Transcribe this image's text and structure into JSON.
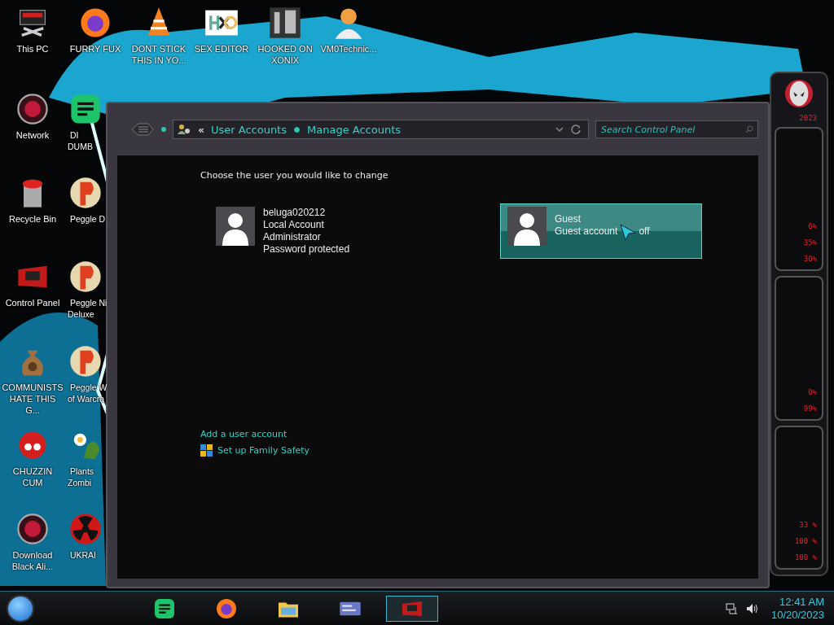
{
  "desktop": {
    "top_row": [
      {
        "label": "This PC",
        "kind": "monitor"
      },
      {
        "label": "FURRY FUX",
        "kind": "browser"
      },
      {
        "label": "DONT STICK THIS IN YO...",
        "kind": "cone"
      },
      {
        "label": "SEX EDITOR",
        "kind": "hex"
      },
      {
        "label": "HOOKED ON XONIX",
        "kind": "maze"
      },
      {
        "label": "VM0Technic...",
        "kind": "person"
      }
    ],
    "column_1": [
      {
        "label": "Network",
        "kind": "orb"
      },
      {
        "label": "Recycle Bin",
        "kind": "bin"
      },
      {
        "label": "Control Panel",
        "kind": "panel"
      },
      {
        "label": "COMMUNISTS HATE THIS G...",
        "kind": "bag"
      },
      {
        "label": "CHUZZIN CUM",
        "kind": "fuzz"
      },
      {
        "label": "Download Black Ali...",
        "kind": "orb"
      }
    ],
    "column_2": [
      {
        "label": "DI\nDUMB",
        "kind": "note"
      },
      {
        "label": "Peggle D",
        "kind": "peg"
      },
      {
        "label": "Peggle Ni\nDeluxe",
        "kind": "peg"
      },
      {
        "label": "Peggle W\nof Warcra",
        "kind": "peg"
      },
      {
        "label": "Plants\nZombi",
        "kind": "flower"
      },
      {
        "label": "UKRAI",
        "kind": "radiation"
      }
    ]
  },
  "window": {
    "breadcrumbs": {
      "overflow": "«",
      "items": [
        "User Accounts",
        "Manage Accounts"
      ]
    },
    "search": {
      "placeholder": "Search Control Panel"
    },
    "heading": "Choose the user you would like to change",
    "accounts": [
      {
        "name": "beluga020212",
        "details": [
          [
            "Local Account"
          ],
          [
            "Administrator"
          ],
          [
            "Password protected"
          ]
        ],
        "selected": false
      },
      {
        "name": "Guest",
        "details": [
          [
            "Guest account",
            "off"
          ]
        ],
        "selected": true
      }
    ],
    "links": [
      {
        "label": "Add a user account",
        "kind": "plain"
      },
      {
        "label": "Set up Family Safety",
        "kind": "shield"
      }
    ]
  },
  "gadget": {
    "year": "2023",
    "panels": [
      [
        "6%",
        "35%",
        "30%"
      ],
      [
        "0%",
        "99%"
      ],
      [
        "33 %",
        "100 %",
        "100 %"
      ]
    ]
  },
  "taskbar": {
    "apps": [
      {
        "kind": "note",
        "selected": false
      },
      {
        "kind": "browser",
        "selected": false
      },
      {
        "kind": "folder",
        "selected": false
      },
      {
        "kind": "card",
        "selected": false
      },
      {
        "kind": "panel",
        "selected": true
      }
    ],
    "time": "12:41 AM",
    "date": "10/20/2023"
  }
}
